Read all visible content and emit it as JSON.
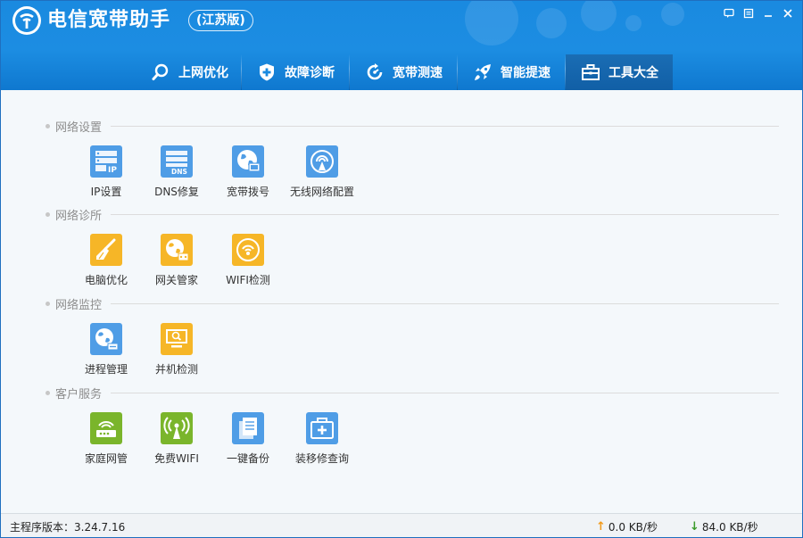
{
  "app": {
    "title": "电信宽带助手",
    "edition": "(江苏版)"
  },
  "colors": {
    "header_blue": "#1a8ae0",
    "active_tab": "#115fa6",
    "icon_blue": "#4f9de6",
    "icon_yellow": "#f6b627",
    "icon_green": "#7ab52b"
  },
  "nav": {
    "items": [
      {
        "label": "上网优化",
        "icon": "search-icon"
      },
      {
        "label": "故障诊断",
        "icon": "shield-plus-icon"
      },
      {
        "label": "宽带测速",
        "icon": "speed-icon"
      },
      {
        "label": "智能提速",
        "icon": "rocket-icon"
      },
      {
        "label": "工具大全",
        "icon": "toolbox-icon",
        "active": true
      }
    ]
  },
  "sections": [
    {
      "title": "网络设置",
      "tools": [
        {
          "label": "IP设置",
          "icon": "ip-server-icon",
          "color": "blue"
        },
        {
          "label": "DNS修复",
          "icon": "dns-server-icon",
          "color": "blue"
        },
        {
          "label": "宽带拨号",
          "icon": "globe-monitor-icon",
          "color": "blue"
        },
        {
          "label": "无线网络配置",
          "icon": "wireless-icon",
          "color": "blue"
        }
      ]
    },
    {
      "title": "网络诊所",
      "tools": [
        {
          "label": "电脑优化",
          "icon": "broom-icon",
          "color": "yellow"
        },
        {
          "label": "网关管家",
          "icon": "globe-gateway-icon",
          "color": "yellow"
        },
        {
          "label": "WIFI检测",
          "icon": "wifi-check-icon",
          "color": "yellow"
        }
      ]
    },
    {
      "title": "网络监控",
      "tools": [
        {
          "label": "进程管理",
          "icon": "globe-process-icon",
          "color": "blue"
        },
        {
          "label": "并机检测",
          "icon": "monitor-search-icon",
          "color": "yellow"
        }
      ]
    },
    {
      "title": "客户服务",
      "tools": [
        {
          "label": "家庭网管",
          "icon": "router-icon",
          "color": "green"
        },
        {
          "label": "免费WIFI",
          "icon": "antenna-icon",
          "color": "green"
        },
        {
          "label": "一键备份",
          "icon": "backup-icon",
          "color": "blue"
        },
        {
          "label": "装移修查询",
          "icon": "repair-kit-icon",
          "color": "blue"
        }
      ]
    }
  ],
  "status": {
    "version": "主程序版本：3.24.7.16",
    "upload": "0.0 KB/秒",
    "download": "84.0 KB/秒",
    "upload_arrow": "↑",
    "download_arrow": "↓"
  }
}
